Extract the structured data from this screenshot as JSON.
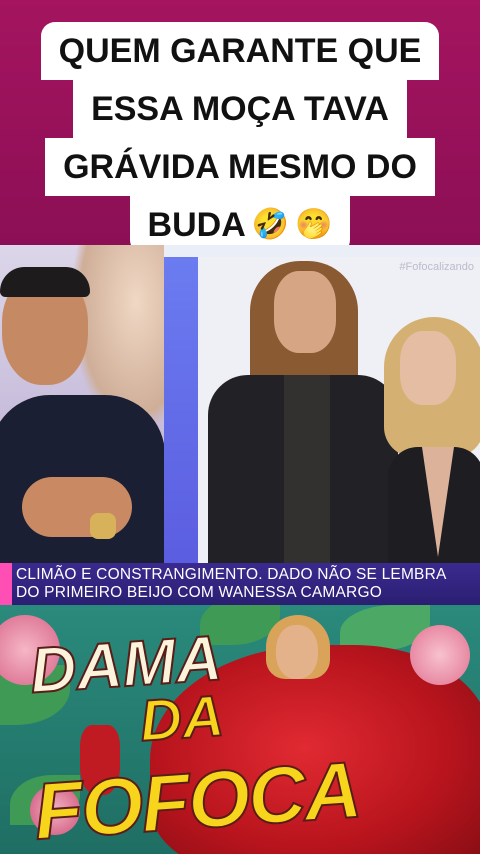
{
  "caption": {
    "lines": [
      "QUEM GARANTE QUE",
      "ESSA MOÇA TAVA",
      "GRÁVIDA MESMO DO",
      "BUDA"
    ],
    "emojis": [
      "🤣",
      "🤭"
    ]
  },
  "video": {
    "watermark": "#Fofocalizando",
    "ticker": {
      "line1": "CLIMÃO E CONSTRANGIMENTO. DADO NÃO SE LEMBRA",
      "line2": "DO PRIMEIRO BEIJO COM WANESSA CAMARGO"
    }
  },
  "brand": {
    "word1": "DAMA",
    "word2": "DA",
    "word3": "FOFOCA"
  },
  "colors": {
    "background": "#8e1257",
    "ticker": "#2a1f72",
    "ticker_accent": "#ff4fb4",
    "title_yellow": "#f6d51c"
  }
}
